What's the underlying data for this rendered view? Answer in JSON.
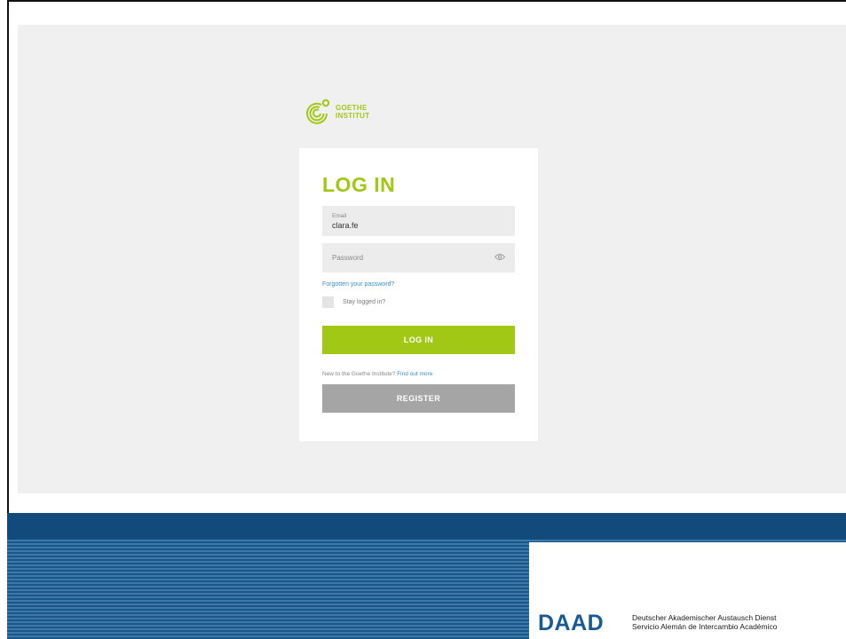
{
  "brand": {
    "logo_line1": "GOETHE",
    "logo_line2": "INSTITUT",
    "accent_color": "#a0c814"
  },
  "login": {
    "title": "LOG IN",
    "email_label": "Email",
    "email_value": "clara.fe",
    "password_placeholder": "Password",
    "forgot_link": "Forgotten your password?",
    "stay_logged_in": "Stay logged in?",
    "login_button": "LOG IN",
    "new_to_text": "New to the Goethe Institute?",
    "find_out_more": "Find out more",
    "register_button": "REGISTER"
  },
  "icons": {
    "show_password": "eye-icon",
    "logo": "goethe-logo-icon"
  },
  "footer": {
    "daad_mark": "DAAD",
    "daad_line1": "Deutscher Akademischer Austausch Dienst",
    "daad_line2": "Servicio Alemán de Intercambio Académico",
    "banner_color": "#1f5585"
  }
}
